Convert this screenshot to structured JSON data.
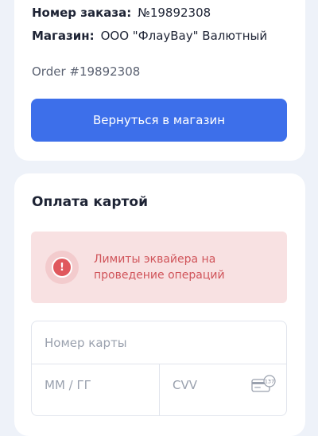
{
  "order": {
    "number_label": "Номер заказа:",
    "number_value": "№19892308",
    "shop_label": "Магазин:",
    "shop_value": "ООО \"ФлауВау\" Валютный",
    "order_code": "Order #19892308",
    "back_button": "Вернуться в магазин"
  },
  "payment": {
    "title": "Оплата картой",
    "alert": {
      "icon": "exclamation-icon",
      "text": "Лимиты эквайера на проведение операций"
    },
    "card_number_placeholder": "Номер карты",
    "expiry_placeholder": "ММ / ГГ",
    "cvv_placeholder": "CVV",
    "cvv_icon": "card-cvv-icon",
    "cvv_icon_text": "137"
  },
  "colors": {
    "accent": "#3d6fea",
    "error_text": "#d0545a",
    "error_bg": "#f8e1e2",
    "page_bg": "#eef2f9"
  }
}
